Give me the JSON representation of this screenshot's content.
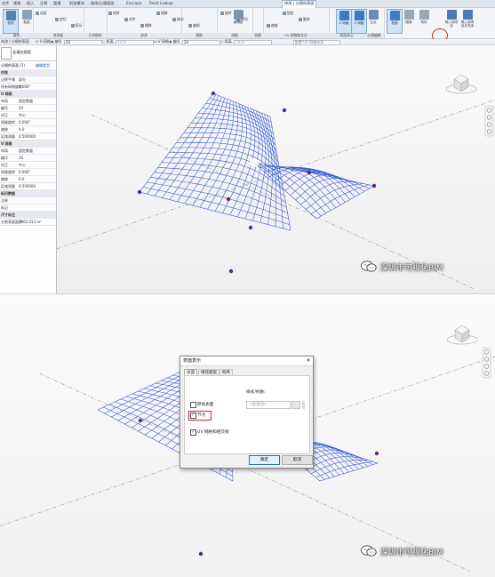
{
  "top": {
    "menu": [
      "文件",
      "建筑",
      "插入",
      "注释",
      "管理",
      "附加模块",
      "修改|分隔表面",
      "Enscape",
      "Revit Lookup",
      "修改 | 分隔的表面"
    ],
    "menu_active_index": 9,
    "ribbon_groups": [
      {
        "label": "属性"
      },
      {
        "label": "剪贴板"
      },
      {
        "label": "几何图形"
      },
      {
        "label": "修改"
      },
      {
        "label": "视图"
      },
      {
        "label": "测量"
      },
      {
        "label": "创建"
      },
      {
        "label": "UV 网格和交点"
      },
      {
        "label": "表面表示"
      },
      {
        "label": "分隔编辑"
      }
    ],
    "ribbon_small_buttons": [
      "连接",
      "剪切",
      "拆分",
      "修剪",
      "对齐",
      "偏移",
      "镜像",
      "移动",
      "复制",
      "旋转",
      "阵列",
      "缩放",
      "锁定",
      "删除"
    ],
    "ribbon_big_buttons": [
      {
        "label": "修改",
        "selected": true
      },
      {
        "label": "粘贴",
        "selected": false
      },
      {
        "label": "编辑族",
        "selected": false
      },
      {
        "label": "U 网格",
        "selected": true
      },
      {
        "label": "V 网格",
        "selected": true
      },
      {
        "label": "交点",
        "selected": false
      },
      {
        "label": "表面",
        "selected": true
      },
      {
        "label": "图案",
        "selected": false
      },
      {
        "label": "构件",
        "selected": false
      },
      {
        "label": "载入到项目",
        "selected": false
      },
      {
        "label": "载入到项目并关闭",
        "selected": false
      }
    ],
    "options_bar": {
      "label": "修改 | 分隔的表面",
      "u_grid_label": "U 网格",
      "numbering_label": "编号",
      "u_value": "20",
      "distance_label": "距离",
      "distance_value": "1910",
      "v_grid_label": "V 网格",
      "v_numbering_label": "编号",
      "v_value": "20",
      "v_distance_label": "距离",
      "v_distance_value": "1910",
      "config_label": "配置 UV 网格布局"
    },
    "properties": {
      "type_name": "无填充图案",
      "selector": "分隔的表面 (1)",
      "edit_type": "编辑类型",
      "rows": [
        {
          "k": "约束",
          "v": "",
          "head": true
        },
        {
          "k": "边界平铺",
          "v": "部分"
        },
        {
          "k": "所有网格旋转",
          "v": "0.000°"
        },
        {
          "k": "U 网格",
          "v": "",
          "head": true
        },
        {
          "k": "布局",
          "v": "固定数量"
        },
        {
          "k": "编号",
          "v": "20"
        },
        {
          "k": "对正",
          "v": "中心"
        },
        {
          "k": "网格旋转",
          "v": "0.000°"
        },
        {
          "k": "偏移",
          "v": "0.0"
        },
        {
          "k": "区域测量",
          "v": "0.500000"
        },
        {
          "k": "V 网格",
          "v": "",
          "head": true
        },
        {
          "k": "布局",
          "v": "固定数量"
        },
        {
          "k": "编号",
          "v": "20"
        },
        {
          "k": "对正",
          "v": "中心"
        },
        {
          "k": "网格旋转",
          "v": "0.000°"
        },
        {
          "k": "偏移",
          "v": "0.0"
        },
        {
          "k": "区域测量",
          "v": "0.500000"
        },
        {
          "k": "标识数据",
          "v": "",
          "head": true
        },
        {
          "k": "注释",
          "v": ""
        },
        {
          "k": "标记",
          "v": ""
        },
        {
          "k": "尺寸标注",
          "v": "",
          "head": true
        },
        {
          "k": "分割表面面积",
          "v": "1062.013 m²"
        }
      ]
    },
    "watermark": "深圳市可视化BIM"
  },
  "dialog": {
    "title": "表面表示",
    "close": "✕",
    "tabs": [
      "表面",
      "填充图案",
      "构件"
    ],
    "selected_tab": 0,
    "style_label": "样式/材质:",
    "style_value": "<按类别>",
    "style_button": "...",
    "original_surface_label": "原始表面",
    "original_surface_checked": false,
    "nodes_label": "节点",
    "nodes_checked": true,
    "uv_label": "UV 网格和相交线",
    "uv_checked": true,
    "ok": "确定",
    "cancel": "取消"
  },
  "bottom": {
    "watermark": "深圳市可视化BIM"
  },
  "colors": {
    "mesh": "#2f55d4",
    "node": "#5a2a82",
    "highlight_circle": "#d9232d",
    "accent": "#2a72c4"
  }
}
